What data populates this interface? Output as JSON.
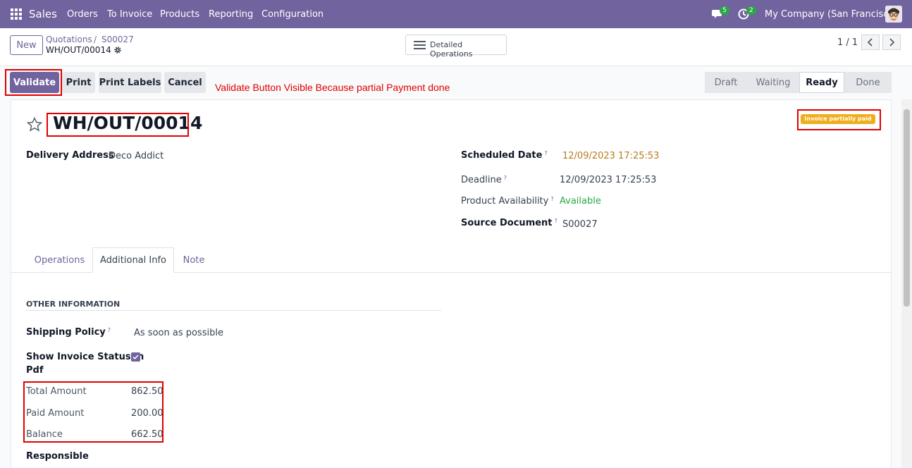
{
  "navbar": {
    "app_name": "Sales",
    "menu": [
      "Orders",
      "To Invoice",
      "Products",
      "Reporting",
      "Configuration"
    ],
    "messages_count": "5",
    "activities_count": "2",
    "company": "My Company (San Francisco)"
  },
  "control_panel": {
    "new_label": "New",
    "breadcrumb_parent": "Quotations",
    "breadcrumb_separator": "/",
    "breadcrumb_order": "S00027",
    "breadcrumb_current": "WH/OUT/00014",
    "detailed_operations_label": "Detailed Operations",
    "pager": "1 / 1"
  },
  "actions": {
    "validate": "Validate",
    "print": "Print",
    "print_labels": "Print Labels",
    "cancel": "Cancel",
    "annotation": "Validate Button Visible Because partial Payment done"
  },
  "statusbar": {
    "stages": [
      "Draft",
      "Waiting",
      "Ready",
      "Done"
    ],
    "active": "Ready"
  },
  "record": {
    "title": "WH/OUT/00014",
    "ribbon": "Invoice partially paid",
    "delivery_address_label": "Delivery Address",
    "delivery_address_value": "Deco Addict",
    "scheduled_date_label": "Scheduled Date",
    "scheduled_date_value": "12/09/2023 17:25:53",
    "deadline_label": "Deadline",
    "deadline_value": "12/09/2023 17:25:53",
    "availability_label": "Product Availability",
    "availability_value": "Available",
    "source_label": "Source Document",
    "source_value": "S00027",
    "help_mark": "?"
  },
  "tabs": {
    "operations": "Operations",
    "additional_info": "Additional Info",
    "note": "Note",
    "active": "Additional Info"
  },
  "other_info": {
    "title": "OTHER INFORMATION",
    "shipping_policy_label": "Shipping Policy",
    "shipping_policy_value": "As soon as possible",
    "show_invoice_label_line1": "Show Invoice Status In",
    "show_invoice_label_line2": "Pdf",
    "show_invoice_checked": true,
    "total_amount_label": "Total Amount",
    "total_amount_value": "862.50",
    "paid_amount_label": "Paid Amount",
    "paid_amount_value": "200.00",
    "balance_label": "Balance",
    "balance_value": "662.50",
    "responsible_label": "Responsible"
  },
  "colors": {
    "brand": "#71639e",
    "ribbon": "#f0ad1c",
    "annotation": "#e00000",
    "available": "#28a745",
    "scheduled_date": "#b77c1a"
  }
}
